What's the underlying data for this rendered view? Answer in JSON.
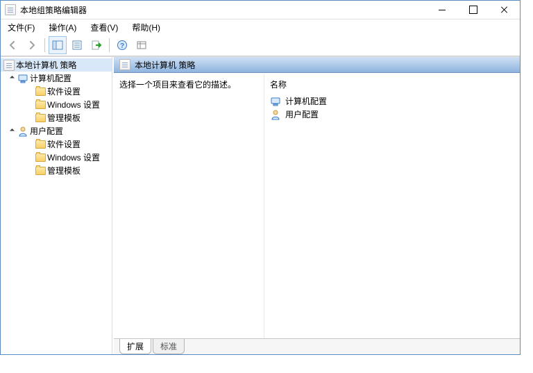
{
  "window": {
    "title": "本地组策略编辑器"
  },
  "menu": {
    "file": "文件(F)",
    "action": "操作(A)",
    "view": "查看(V)",
    "help": "帮助(H)"
  },
  "tree": {
    "root": "本地计算机 策略",
    "node_computer": "计算机配置",
    "node_user": "用户配置",
    "leaf_software": "软件设置",
    "leaf_windows": "Windows 设置",
    "leaf_admin": "管理模板"
  },
  "rightpane": {
    "header": "本地计算机 策略",
    "desc_prompt": "选择一个项目来查看它的描述。",
    "col_name": "名称",
    "item_computer": "计算机配置",
    "item_user": "用户配置",
    "tab_extended": "扩展",
    "tab_standard": "标准"
  }
}
